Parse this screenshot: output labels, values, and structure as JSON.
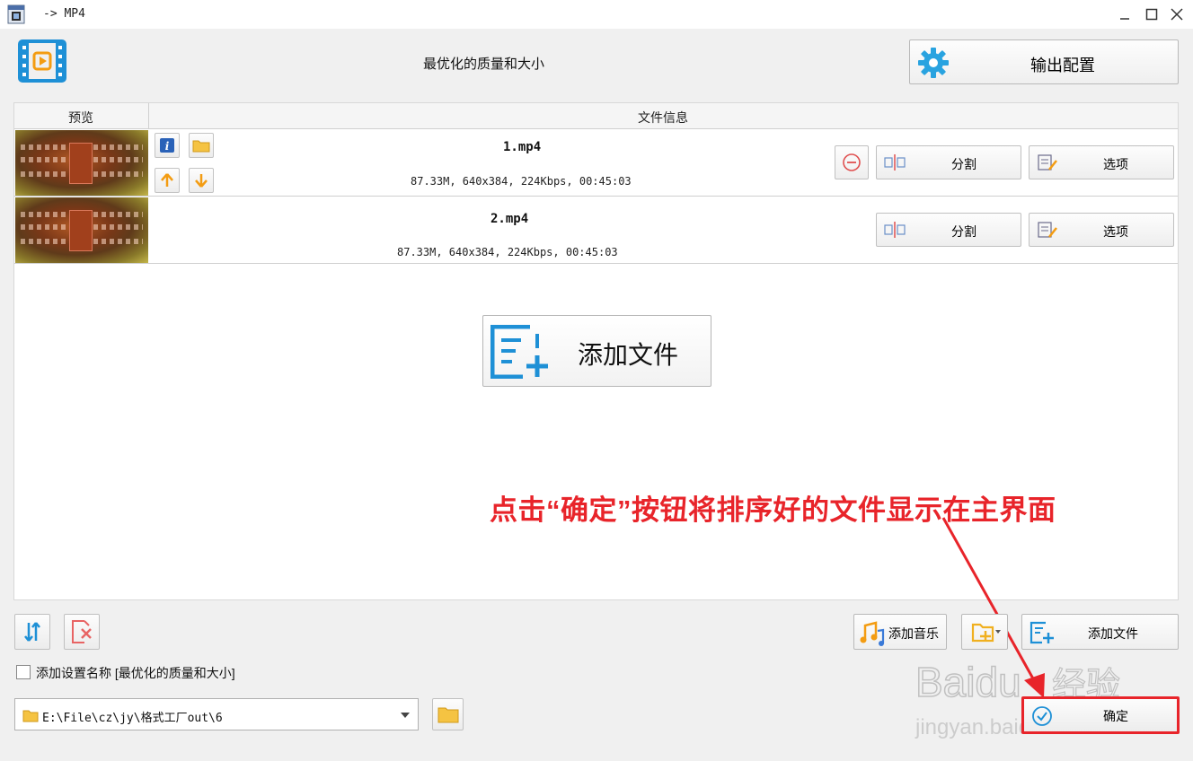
{
  "window": {
    "title": "-> MP4",
    "minimize_icon": "minimize-icon",
    "maximize_icon": "maximize-icon",
    "close_icon": "close-icon"
  },
  "header": {
    "preset_title": "最优化的质量和大小",
    "output_config_label": "输出配置"
  },
  "table": {
    "columns": [
      "预览",
      "文件信息"
    ],
    "rows": [
      {
        "name": "1.mp4",
        "info": "87.33M, 640x384, 224Kbps, 00:45:03",
        "split_label": "分割",
        "options_label": "选项"
      },
      {
        "name": "2.mp4",
        "info": "87.33M, 640x384, 224Kbps, 00:45:03",
        "split_label": "分割",
        "options_label": "选项"
      }
    ],
    "add_file_big_label": "添加文件"
  },
  "annotation": {
    "text": "点击“确定”按钮将排序好的文件显示在主界面",
    "color": "#e8242a"
  },
  "bottom": {
    "add_music_label": "添加音乐",
    "add_file_label": "添加文件",
    "add_setting_name_label": "添加设置名称 [最优化的质量和大小]",
    "output_path": "E:\\File\\cz\\jy\\格式工厂out\\6",
    "confirm_label": "确定"
  },
  "watermark": {
    "brand": "Baidu经验",
    "url": "jingyan.baidu.com"
  },
  "colors": {
    "accent_blue": "#1e90d6",
    "arrow_orange": "#f39c12",
    "danger_red": "#e8242a"
  }
}
